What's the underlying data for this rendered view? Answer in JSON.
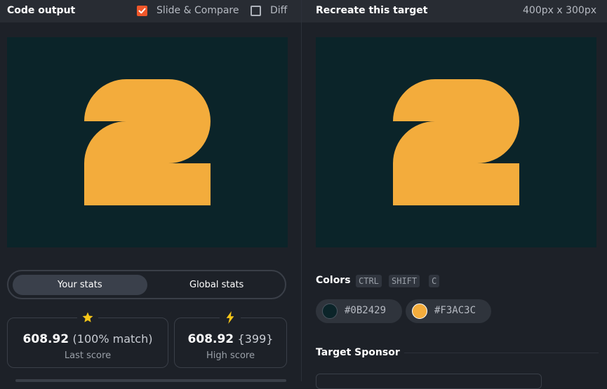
{
  "code_output": {
    "title": "Code output",
    "slide_compare": {
      "label": "Slide & Compare",
      "checked": true
    },
    "diff": {
      "label": "Diff",
      "checked": false
    }
  },
  "target": {
    "title": "Recreate this target",
    "dimensions": "400px x 300px"
  },
  "stats": {
    "tabs": {
      "active": "Your stats",
      "inactive": "Global stats"
    },
    "last": {
      "icon": "star-icon",
      "score": "608.92",
      "detail": "(100% match)",
      "label": "Last score"
    },
    "high": {
      "icon": "lightning-icon",
      "score": "608.92",
      "detail": "{399}",
      "label": "High score"
    }
  },
  "colors": {
    "title": "Colors",
    "shortcut": [
      "CTRL",
      "SHIFT",
      "C"
    ],
    "items": [
      {
        "hex": "#0B2429",
        "color": "#0b2429"
      },
      {
        "hex": "#F3AC3C",
        "color": "#f3ac3c"
      }
    ]
  },
  "sponsor": {
    "title": "Target Sponsor"
  },
  "theme": {
    "canvas_bg": "#0b2429",
    "shape_fill": "#f3ac3c",
    "accent": "#f0572a",
    "icon_yellow": "#f5c518"
  }
}
